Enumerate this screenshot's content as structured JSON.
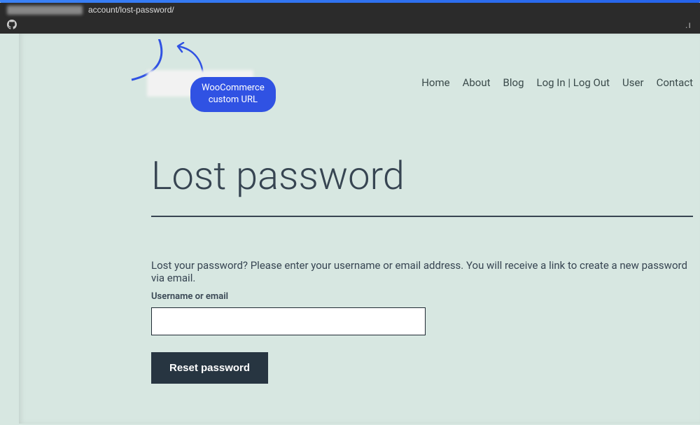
{
  "browser": {
    "url_visible_suffix": "account/lost-password/"
  },
  "annotation": {
    "callout_line1": "WooCommerce",
    "callout_line2": "custom URL"
  },
  "logo": {
    "line1": "",
    "line2": ""
  },
  "nav": {
    "items": [
      {
        "label": "Home"
      },
      {
        "label": "About"
      },
      {
        "label": "Blog"
      },
      {
        "label": "Log In | Log Out"
      },
      {
        "label": "User"
      },
      {
        "label": "Contact"
      }
    ]
  },
  "page": {
    "title": "Lost password",
    "instructions": "Lost your password? Please enter your username or email address. You will receive a link to create a new password via email.",
    "field_label": "Username or email",
    "input_value": "",
    "submit_label": "Reset password"
  }
}
